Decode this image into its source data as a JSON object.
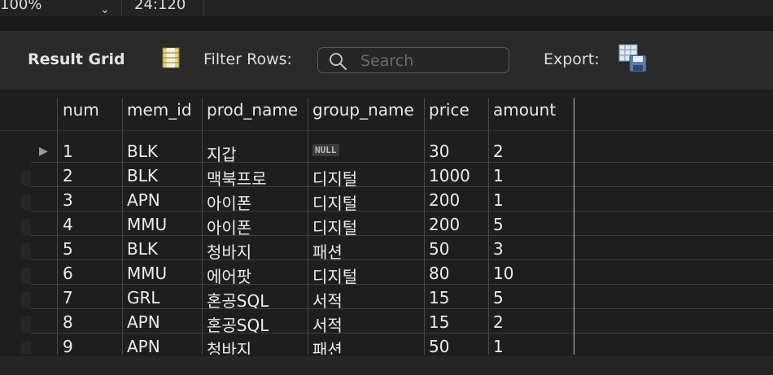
{
  "topbar": {
    "zoom": "100%",
    "cursor_position": "24:120"
  },
  "toolbar": {
    "result_grid_label": "Result Grid",
    "filter_rows_label": "Filter Rows:",
    "search_placeholder": "Search",
    "export_label": "Export:"
  },
  "grid": {
    "columns": [
      "num",
      "mem_id",
      "prod_name",
      "group_name",
      "price",
      "amount"
    ],
    "null_label": "NULL",
    "rows": [
      [
        "1",
        "BLK",
        "지갑",
        null,
        "30",
        "2"
      ],
      [
        "2",
        "BLK",
        "맥북프로",
        "디지털",
        "1000",
        "1"
      ],
      [
        "3",
        "APN",
        "아이폰",
        "디지털",
        "200",
        "1"
      ],
      [
        "4",
        "MMU",
        "아이폰",
        "디지털",
        "200",
        "5"
      ],
      [
        "5",
        "BLK",
        "청바지",
        "패션",
        "50",
        "3"
      ],
      [
        "6",
        "MMU",
        "에어팟",
        "디지털",
        "80",
        "10"
      ],
      [
        "7",
        "GRL",
        "혼공SQL",
        "서적",
        "15",
        "5"
      ],
      [
        "8",
        "APN",
        "혼공SQL",
        "서적",
        "15",
        "2"
      ],
      [
        "9",
        "APN",
        "청바지",
        "패션",
        "50",
        "1"
      ]
    ]
  }
}
